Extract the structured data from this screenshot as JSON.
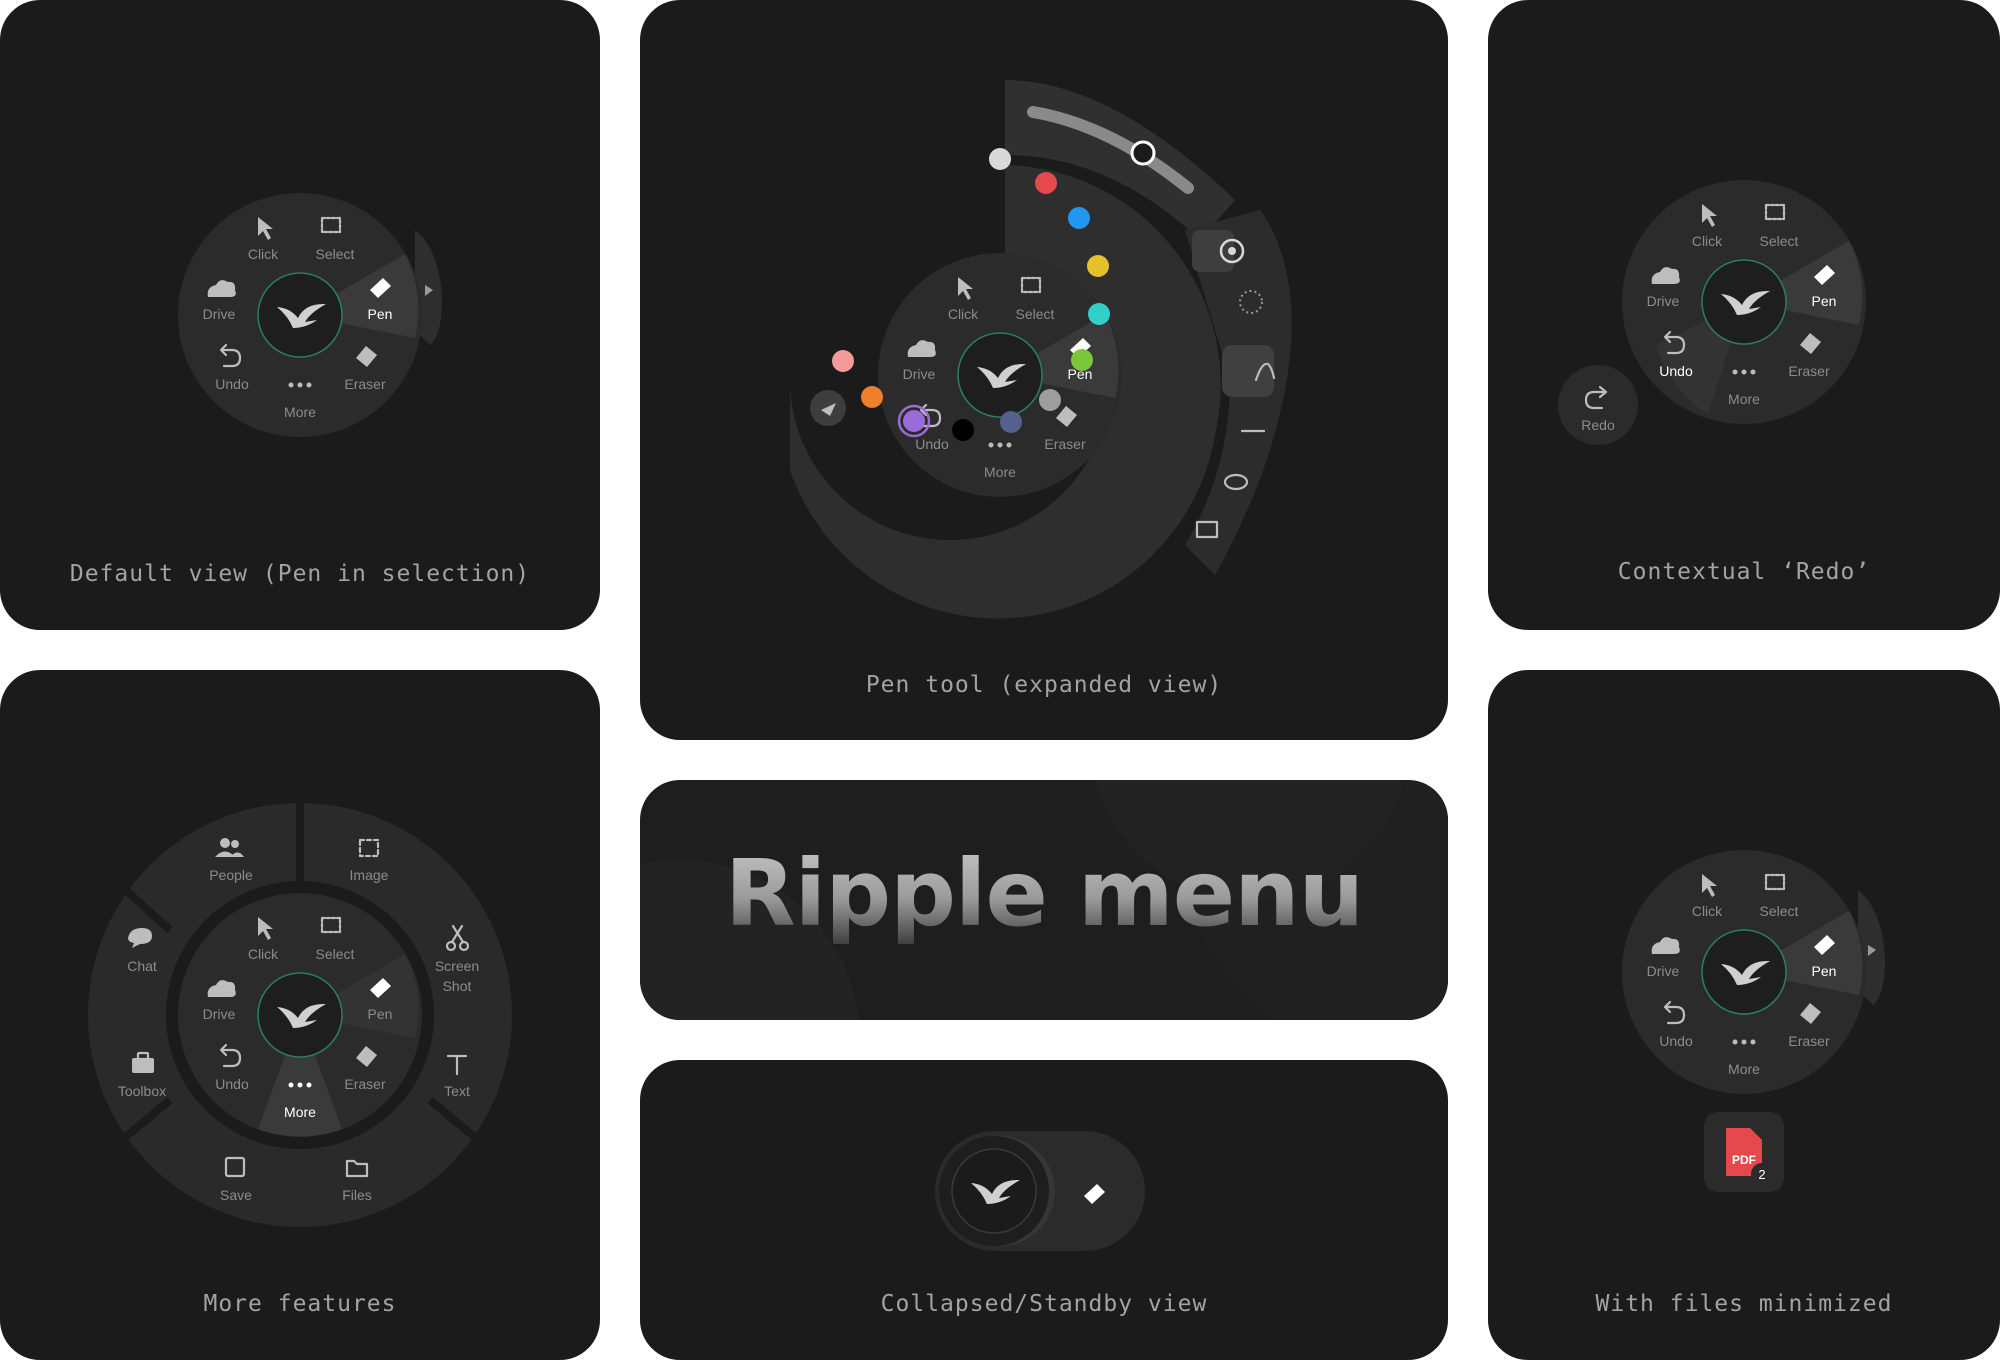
{
  "title": "Ripple menu",
  "captions": {
    "default": "Default view (Pen in selection)",
    "pen_expanded": "Pen tool (expanded view)",
    "redo": "Contextual ‘Redo’",
    "more": "More features",
    "collapsed": "Collapsed/Standby view",
    "files": "With files minimized"
  },
  "menu": {
    "click": "Click",
    "select": "Select",
    "drive": "Drive",
    "pen": "Pen",
    "undo": "Undo",
    "eraser": "Eraser",
    "more": "More"
  },
  "redo_label": "Redo",
  "more_features": {
    "people": "People",
    "image": "Image",
    "chat": "Chat",
    "screen_shot_line1": "Screen",
    "screen_shot_line2": "Shot",
    "toolbox": "Toolbox",
    "text": "Text",
    "save": "Save",
    "files": "Files"
  },
  "files_badge": {
    "label": "PDF",
    "count": "2"
  },
  "pen_colors": [
    "#d9d9d9",
    "#e5484d",
    "#2196f3",
    "#e5c12a",
    "#2fd0c8",
    "#7cc63a",
    "#9e9e9e",
    "#55608f",
    "#000000",
    "#9a6cd8",
    "#f07f2c",
    "#f59a9a"
  ],
  "accent": "#2a7f63"
}
